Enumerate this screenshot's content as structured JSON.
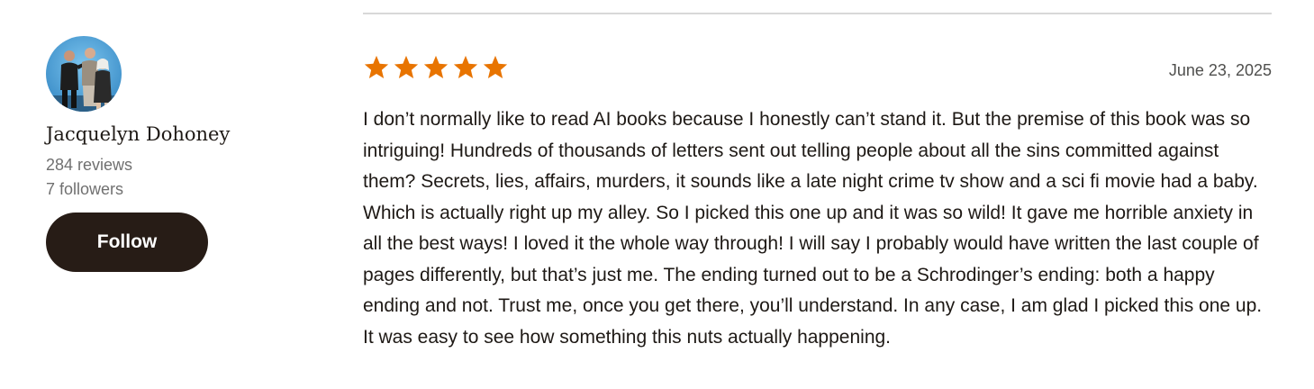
{
  "reviewer": {
    "name": "Jacquelyn Dohoney",
    "reviews": "284 reviews",
    "followers": "7 followers",
    "follow_label": "Follow"
  },
  "review": {
    "rating": 5,
    "rating_max": 5,
    "star_color": "#e87400",
    "date": "June 23, 2025",
    "text": "I don’t normally like to read AI books because I honestly can’t stand it. But the premise of this book was so intriguing! Hundreds of thousands of letters sent out telling people about all the sins committed against them? Secrets, lies, affairs, murders, it sounds like a late night crime tv show and a sci fi movie had a baby. Which is actually right up my alley. So I picked this one up and it was so wild! It gave me horrible anxiety in all the best ways! I loved it the whole way through! I will say I probably would have written the last couple of pages differently, but that’s just me. The ending turned out to be a Schrodinger’s ending: both a happy ending and not. Trust me, once you get there, you’ll understand. In any case, I am glad I picked this one up. It was easy to see how something this nuts actually happening."
  },
  "colors": {
    "follow_button_bg": "#271c16",
    "text": "#1e1915",
    "muted": "#707070",
    "divider": "#d8d8d8"
  }
}
